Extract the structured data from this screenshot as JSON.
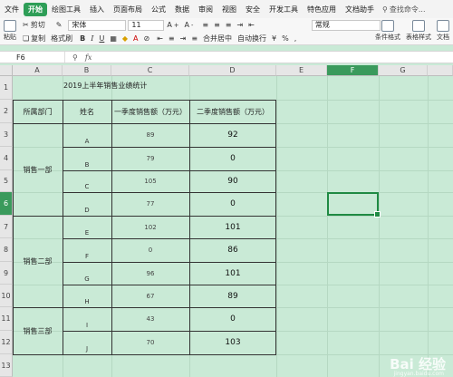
{
  "menubar": {
    "items": [
      "文件",
      "开始",
      "绘图工具",
      "插入",
      "页面布局",
      "公式",
      "数据",
      "审阅",
      "视图",
      "安全",
      "开发工具",
      "特色应用",
      "文档助手"
    ],
    "active_index": 1,
    "search": "查找命令..."
  },
  "toolbar": {
    "cut": "剪切",
    "paste": "粘贴",
    "copy": "复制",
    "format_painter": "格式刷",
    "font_name": "宋体",
    "font_size": "11",
    "bold": "B",
    "italic": "I",
    "underline": "U",
    "merge_center": "合并居中",
    "auto_wrap": "自动换行",
    "number_format": "常规",
    "cond_format": "条件格式",
    "table_style": "表格样式",
    "doc_assist": "文档"
  },
  "formula_bar": {
    "cell_ref": "F6",
    "fx": "fx"
  },
  "columns": [
    "A",
    "B",
    "C",
    "D",
    "E",
    "F",
    "G"
  ],
  "rows": [
    "1",
    "2",
    "3",
    "4",
    "5",
    "6",
    "7",
    "8",
    "9",
    "10",
    "11",
    "12",
    "13"
  ],
  "selected": {
    "column": "F",
    "row": "6"
  },
  "sheet": {
    "title": "2019上半年销售业绩统计",
    "headers": {
      "dept": "所属部门",
      "name": "姓名",
      "q1": "一季度销售额（万元）",
      "q2": "二季度销售额（万元）"
    },
    "departments": [
      "销售一部",
      "销售二部",
      "销售三部"
    ],
    "names": [
      "A",
      "B",
      "C",
      "D",
      "E",
      "F",
      "G",
      "H",
      "I",
      "J"
    ],
    "q1": [
      "89",
      "79",
      "105",
      "77",
      "102",
      "0",
      "96",
      "67",
      "43",
      "70"
    ],
    "q2": [
      "92",
      "0",
      "90",
      "0",
      "101",
      "86",
      "101",
      "89",
      "0",
      "103"
    ]
  },
  "watermark": {
    "logo": "Bai 经验",
    "url": "jingyan.baidu.com"
  }
}
